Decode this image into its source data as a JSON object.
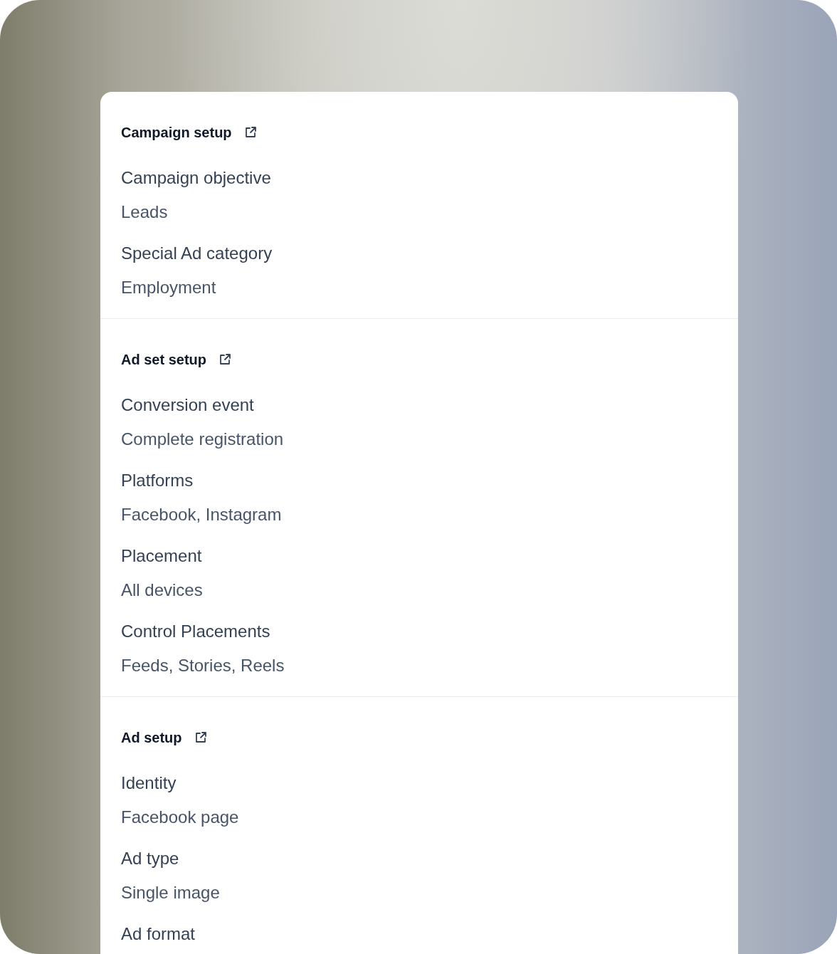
{
  "sections": [
    {
      "title": "Campaign setup",
      "fields": [
        {
          "label": "Campaign objective",
          "value": "Leads"
        },
        {
          "label": "Special Ad category",
          "value": "Employment"
        }
      ]
    },
    {
      "title": "Ad set setup",
      "fields": [
        {
          "label": "Conversion event",
          "value": "Complete registration"
        },
        {
          "label": "Platforms",
          "value": "Facebook, Instagram"
        },
        {
          "label": "Placement",
          "value": "All devices"
        },
        {
          "label": "Control Placements",
          "value": "Feeds, Stories, Reels"
        }
      ]
    },
    {
      "title": "Ad setup",
      "fields": [
        {
          "label": "Identity",
          "value": "Facebook page"
        },
        {
          "label": "Ad type",
          "value": "Single image"
        },
        {
          "label": "Ad format"
        }
      ]
    }
  ]
}
